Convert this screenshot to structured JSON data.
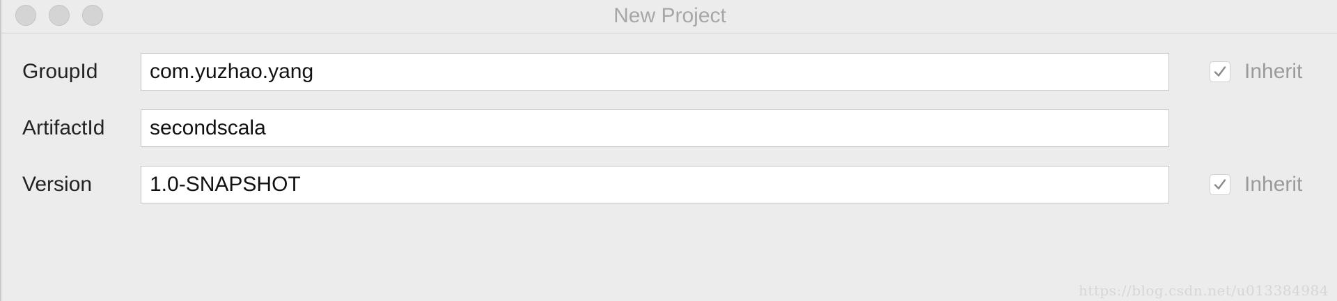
{
  "window": {
    "title": "New Project"
  },
  "form": {
    "fields": [
      {
        "label": "GroupId",
        "value": "com.yuzhao.yang",
        "inherit": {
          "shown": true,
          "checked": true,
          "label": "Inherit"
        }
      },
      {
        "label": "ArtifactId",
        "value": "secondscala",
        "inherit": {
          "shown": false
        }
      },
      {
        "label": "Version",
        "value": "1.0-SNAPSHOT",
        "inherit": {
          "shown": true,
          "checked": true,
          "label": "Inherit"
        }
      }
    ]
  },
  "icons": {
    "checkbox": "checkmark-icon",
    "traffic_lights": [
      "close-icon",
      "minimize-icon",
      "maximize-icon"
    ]
  },
  "colors": {
    "background": "#ececec",
    "field_background": "#ffffff",
    "title_text": "#a7a7a7",
    "label_text": "#232323",
    "inherit_text": "#9a9a9a"
  },
  "watermark": "https://blog.csdn.net/u013384984"
}
